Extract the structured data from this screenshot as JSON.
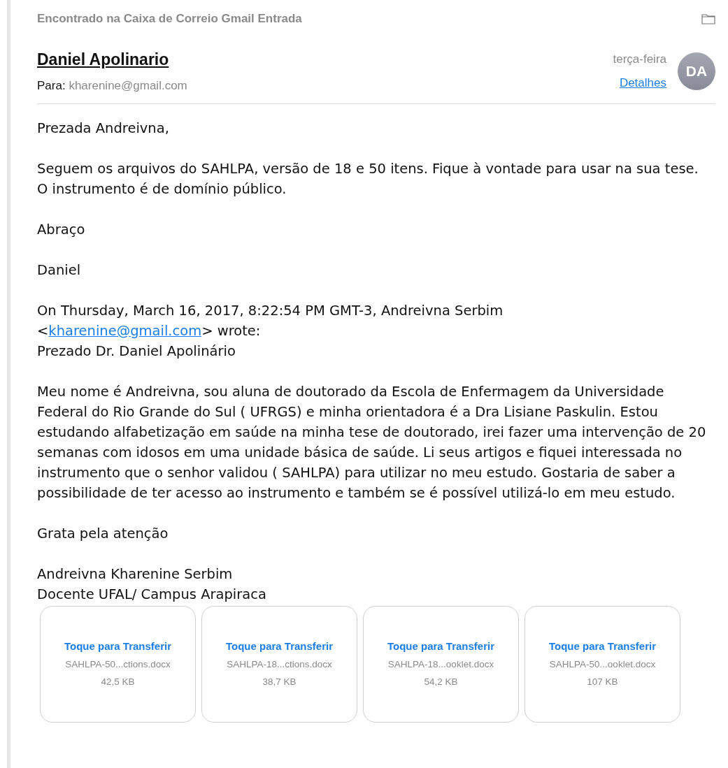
{
  "location": "Encontrado na Caixa de Correio Gmail Entrada",
  "sender": {
    "name": "Daniel Apolinario",
    "initials": "DA",
    "date": "terça-feira",
    "details_link": "Detalhes"
  },
  "recipient": {
    "label": "Para:",
    "address": "kharenine@gmail.com"
  },
  "reply_paragraphs": [
    "Prezada Andreivna,",
    "Seguem os arquivos do SAHLPA, versão de 18 e 50 itens. Fique à vontade para usar na sua tese. O instrumento é de domínio público.",
    "Abraço",
    "Daniel"
  ],
  "attribution": {
    "before": "On Thursday, March 16, 2017, 8:22:54 PM GMT-3, Andreivna Serbim",
    "open": "<",
    "email": "kharenine@gmail.com",
    "after": "> wrote:"
  },
  "quoted_paragraphs": [
    "Prezado Dr. Daniel Apolinário",
    "Meu nome é Andreivna, sou aluna de doutorado da Escola de Enfermagem da Universidade Federal do Rio Grande do Sul ( UFRGS) e minha orientadora é a Dra Lisiane Paskulin. Estou estudando alfabetização em saúde na minha tese de doutorado, irei fazer uma intervenção de 20 semanas com idosos em uma unidade básica de saúde. Li seus artigos e fiquei interessada no instrumento que o senhor validou ( SAHLPA) para utilizar no meu estudo. Gostaria de saber a possibilidade de ter acesso ao instrumento e também se é possível utilizá-lo em meu estudo.",
    "Grata pela atenção"
  ],
  "signature": [
    "Andreivna Kharenine Serbim",
    "Docente UFAL/ Campus Arapiraca"
  ],
  "attachments": [
    {
      "action": "Toque para Transferir",
      "filename": "SAHLPA-50...ctions.docx",
      "size": "42,5 KB"
    },
    {
      "action": "Toque para Transferir",
      "filename": "SAHLPA-18...ctions.docx",
      "size": "38,7 KB"
    },
    {
      "action": "Toque para Transferir",
      "filename": "SAHLPA-18...ooklet.docx",
      "size": "54,2 KB"
    },
    {
      "action": "Toque para Transferir",
      "filename": "SAHLPA-50...ooklet.docx",
      "size": "107 KB"
    }
  ]
}
